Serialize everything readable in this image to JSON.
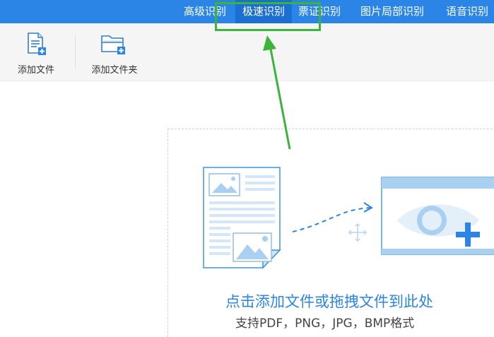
{
  "nav": {
    "tabs": [
      {
        "label": "高级识别"
      },
      {
        "label": "极速识别"
      },
      {
        "label": "票证识别"
      },
      {
        "label": "图片局部识别"
      },
      {
        "label": "语音识别"
      }
    ],
    "active_index": 1
  },
  "toolbar": {
    "add_file_label": "添加文件",
    "add_folder_label": "添加文件夹"
  },
  "dropzone": {
    "title": "点击添加文件或拖拽文件到此处",
    "subtitle": "支持PDF，PNG，JPG，BMP格式"
  },
  "colors": {
    "nav_bg": "#2a85e6",
    "active_tab_bg": "#1a6fd1",
    "highlight": "#3ab53a",
    "accent": "#2a85e6"
  }
}
